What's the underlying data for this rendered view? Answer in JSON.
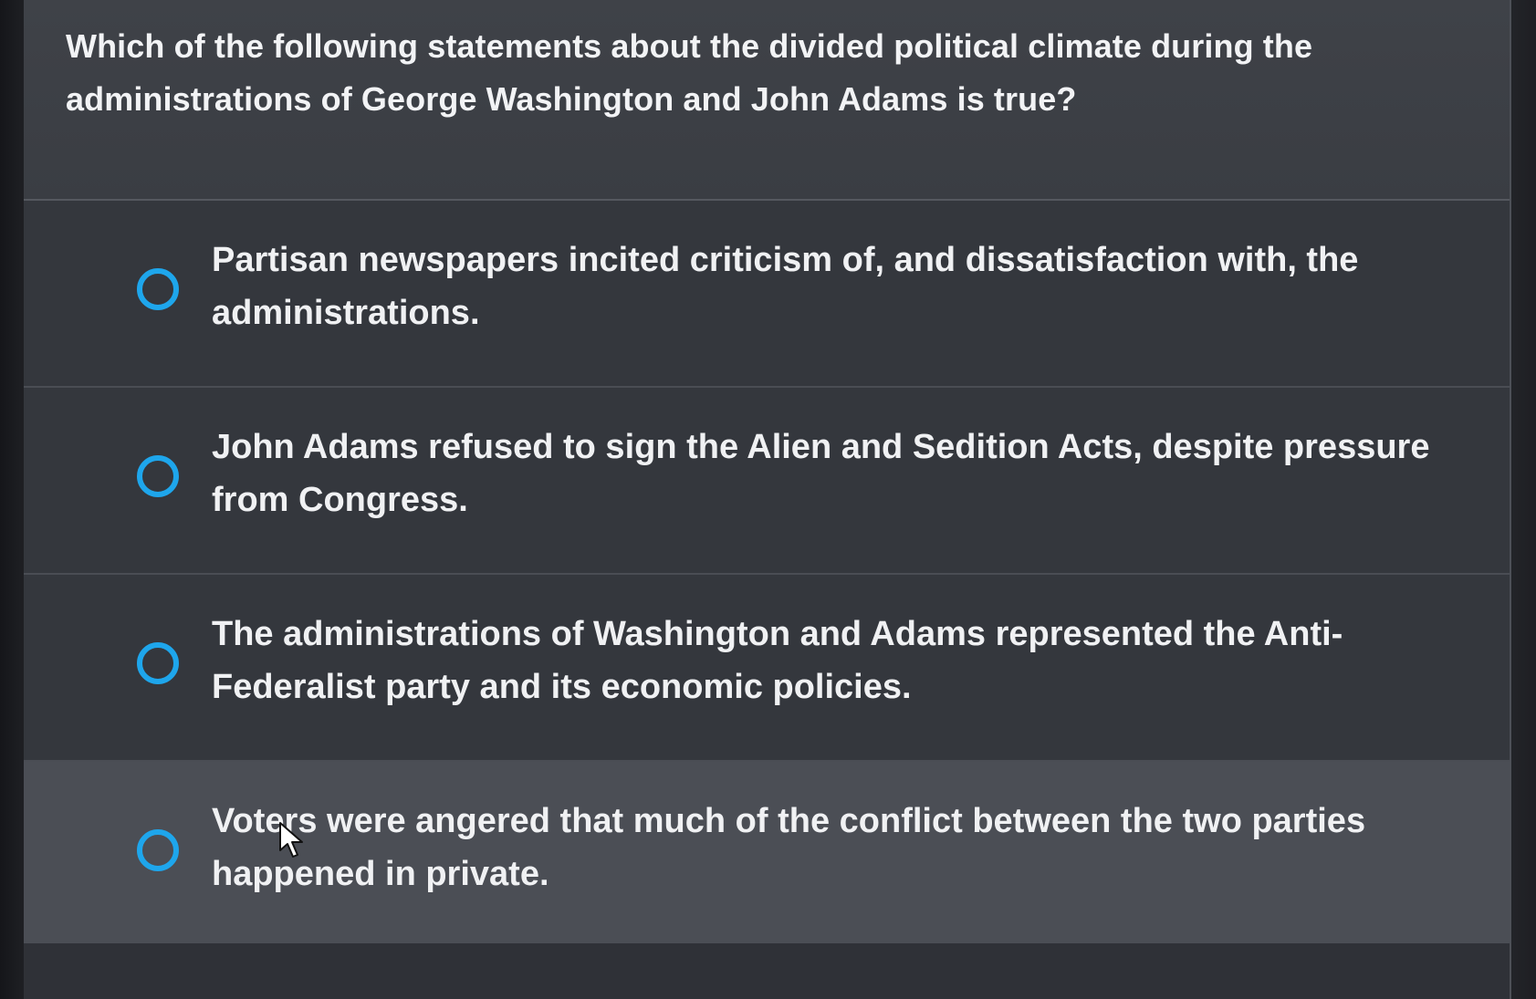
{
  "question": {
    "text": "Which of the following statements about the divided political climate during the administrations of George Washington and John Adams is true?"
  },
  "choices": [
    {
      "label": "Partisan newspapers incited criticism of, and dissatisfaction with, the administrations."
    },
    {
      "label": "John Adams refused to sign the Alien and Sedition Acts, despite pressure from Congress."
    },
    {
      "label": "The administrations of Washington and Adams represented the Anti-Federalist party and its economic policies."
    },
    {
      "label": "Voters were angered that much of the conflict between the two parties happened in private."
    }
  ],
  "colors": {
    "radio_accent": "#1ea6ec",
    "panel_background": "#3a3d43",
    "hovered_choice_background": "#4b4e55",
    "text": "#f0f1f3"
  },
  "icons": {
    "radio": "radio-unselected-icon",
    "cursor": "mouse-pointer-icon"
  }
}
